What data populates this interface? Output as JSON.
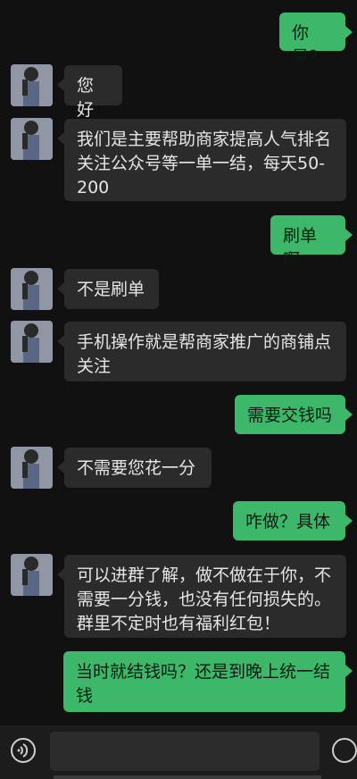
{
  "messages": [
    {
      "side": "out",
      "text": "你是？"
    },
    {
      "side": "in",
      "text": "您好"
    },
    {
      "side": "in",
      "text": "我们是主要帮助商家提高人气排名关注公众号等一单一结，每天50-200"
    },
    {
      "side": "out",
      "text": "刷单啊"
    },
    {
      "side": "in",
      "text": "不是刷单"
    },
    {
      "side": "in",
      "text": "手机操作就是帮商家推广的商铺点关注"
    },
    {
      "side": "out",
      "text": "需要交钱吗"
    },
    {
      "side": "in",
      "text": "不需要您花一分"
    },
    {
      "side": "out",
      "text": "咋做？具体"
    },
    {
      "side": "in",
      "text": "可以进群了解，做不做在于你，不需要一分钱，也没有任何损失的。群里不定时也有福利红包！"
    },
    {
      "side": "out",
      "text": "当时就结钱吗？还是到晚上统一结钱"
    }
  ],
  "colors": {
    "background": "#111111",
    "incoming_bubble": "#2b2b2b",
    "outgoing_bubble": "#3db86b"
  },
  "input_bar": {
    "left_icon": "voice-icon",
    "right_icon": "emoji-icon"
  }
}
